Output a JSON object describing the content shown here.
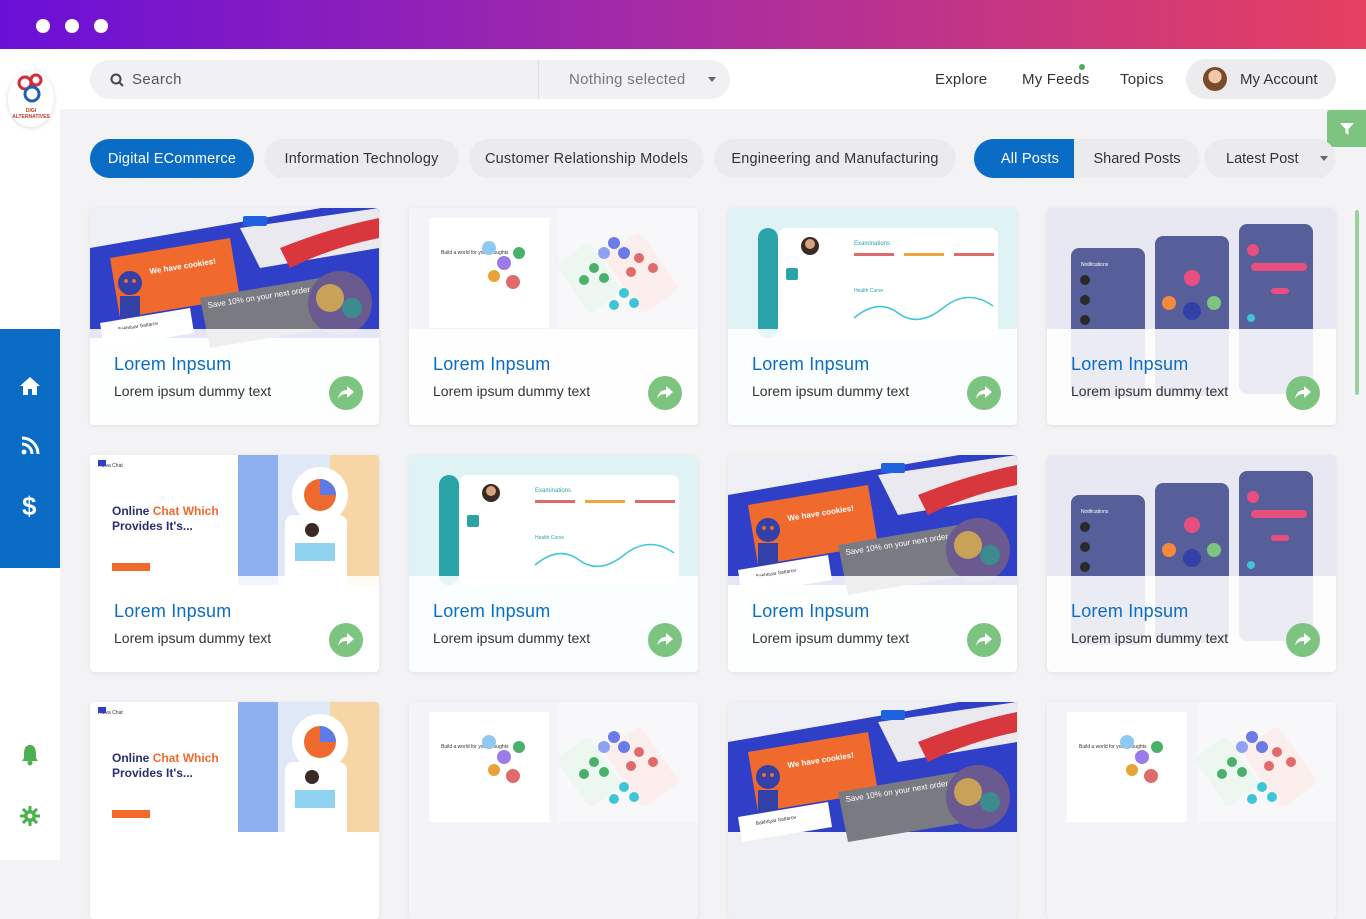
{
  "window": {
    "dots": 3
  },
  "brand": {
    "logo_text": "DIGI ALTERNATIVES"
  },
  "search": {
    "placeholder": "Search",
    "select_value": "Nothing selected"
  },
  "nav": {
    "explore": "Explore",
    "my_feeds": "My Feeds",
    "topics": "Topics",
    "account": "My Account"
  },
  "categories": [
    "Digital ECommerce",
    "Information Technology",
    "Customer Relationship Models",
    "Engineering and Manufacturing"
  ],
  "post_tabs": {
    "all": "All Posts",
    "shared": "Shared Posts",
    "sort": "Latest Post"
  },
  "cards": [
    {
      "title": "Lorem Inpsum",
      "text": "Lorem ipsum dummy text",
      "thumb": "cookies"
    },
    {
      "title": "Lorem Inpsum",
      "text": "Lorem ipsum dummy text",
      "thumb": "world"
    },
    {
      "title": "Lorem Inpsum",
      "text": "Lorem ipsum dummy text",
      "thumb": "health"
    },
    {
      "title": "Lorem Inpsum",
      "text": "Lorem ipsum dummy text",
      "thumb": "mobile"
    },
    {
      "title": "Lorem Inpsum",
      "text": "Lorem ipsum dummy text",
      "thumb": "chat"
    },
    {
      "title": "Lorem Inpsum",
      "text": "Lorem ipsum dummy text",
      "thumb": "health"
    },
    {
      "title": "Lorem Inpsum",
      "text": "Lorem ipsum dummy text",
      "thumb": "cookies"
    },
    {
      "title": "Lorem Inpsum",
      "text": "Lorem ipsum dummy text",
      "thumb": "mobile"
    },
    {
      "title": "",
      "text": "",
      "thumb": "chat"
    },
    {
      "title": "",
      "text": "",
      "thumb": "world"
    },
    {
      "title": "",
      "text": "",
      "thumb": "cookies"
    },
    {
      "title": "",
      "text": "",
      "thumb": "world"
    }
  ],
  "thumb_text": {
    "cookies_heading": "We have cookies!",
    "cookies_save": "Save 10% on your next order",
    "cookies_name": "Bakhtiyar Sattarov",
    "chat_heading_1": "Online",
    "chat_heading_2": "Chat Which",
    "chat_heading_3": "Provides It's...",
    "chat_brand": "Ruiva Chat",
    "world_heading": "Build a world for your thoughts",
    "health_title": "Examinations",
    "health_curve": "Health Curve",
    "mobile_title": "Notifications"
  },
  "colors": {
    "accent": "#0a6cc4",
    "green": "#7cc47f",
    "titlebar_start": "#6a0fd8",
    "titlebar_end": "#e64060"
  }
}
